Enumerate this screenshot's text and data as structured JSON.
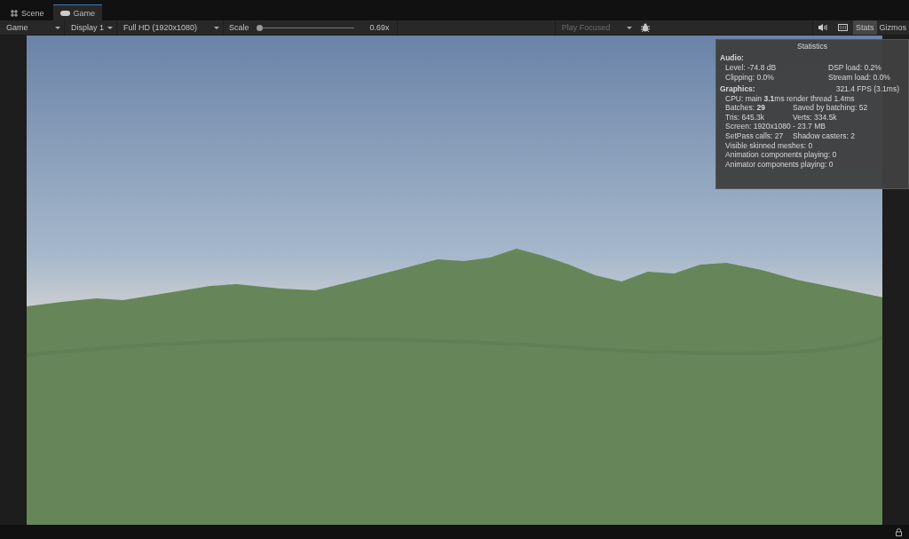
{
  "tabs": [
    {
      "label": "Scene",
      "selected": false
    },
    {
      "label": "Game",
      "selected": true
    }
  ],
  "toolbar": {
    "view_dropdown": "Game",
    "display_dropdown": "Display 1",
    "resolution_dropdown": "Full HD (1920x1080)",
    "scale_label": "Scale",
    "scale": {
      "level": 0.0
    },
    "scale_reading": "0.69x",
    "play_mode_dropdown": "Play Focused",
    "stats": {
      "label": "Stats",
      "selected": true
    },
    "gizmos": "Gizmos"
  },
  "statistics": {
    "title": "Statistics",
    "sections": [
      {
        "heading": "Audio:",
        "rows": [
          [
            "Level: -74.8 dB",
            "DSP load: 0.2%"
          ],
          [
            "Clipping: 0.0%",
            "Stream load: 0.0%"
          ]
        ]
      },
      {
        "heading": "Graphics:",
        "heading_right": "321.4 FPS (3.1ms)",
        "rows": [
          [
            "CPU: main **3.1**ms  render thread 1.4ms"
          ],
          [
            "Batches: **29**",
            "Saved by batching: 52"
          ],
          [
            "Tris: 645.3k",
            "Verts: 334.5k"
          ],
          [
            "Screen: 1920x1080 - 23.7 MB"
          ],
          [
            "SetPass calls: 27",
            "Shadow casters: 2"
          ],
          [
            "Visible skinned meshes: 0"
          ],
          [
            "Animation components playing: 0"
          ],
          [
            "Animator components playing: 0"
          ]
        ]
      }
    ]
  }
}
